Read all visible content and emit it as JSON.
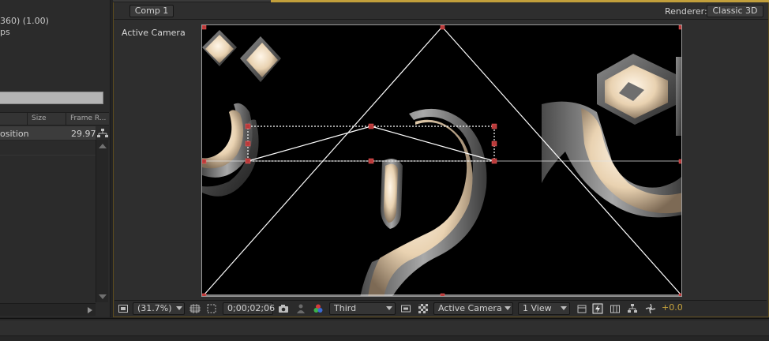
{
  "project": {
    "info_line1": "360) (1.00)",
    "info_line2": "ps",
    "columns": {
      "size": "Size",
      "frame_rate": "Frame R..."
    },
    "rows": [
      {
        "name": "osition",
        "frame_rate": "29.97"
      }
    ]
  },
  "composition": {
    "tab_label": "Comp 1",
    "renderer_label": "Renderer:",
    "renderer_value": "Classic 3D",
    "view_label": "Active Camera"
  },
  "toolbar": {
    "zoom": "(31.7%)",
    "timecode": "0;00;02;06",
    "resolution": "Third",
    "camera": "Active Camera",
    "views": "1 View",
    "exposure": "+0.0"
  },
  "colors": {
    "accent": "#c29f3b",
    "handle": "#b83a3a",
    "glyph_fill": "#f3e3cc",
    "exposure": "#c9a53d"
  },
  "icons": [
    "snapshot-icon",
    "show-snapshot-icon",
    "channel-icon",
    "region-of-interest-icon",
    "transparency-grid-icon",
    "fast-preview-icon",
    "timeline-icon",
    "flowchart-icon",
    "exposure-reset-icon",
    "grid-icon",
    "mask-toggle-icon",
    "always-preview-icon"
  ]
}
